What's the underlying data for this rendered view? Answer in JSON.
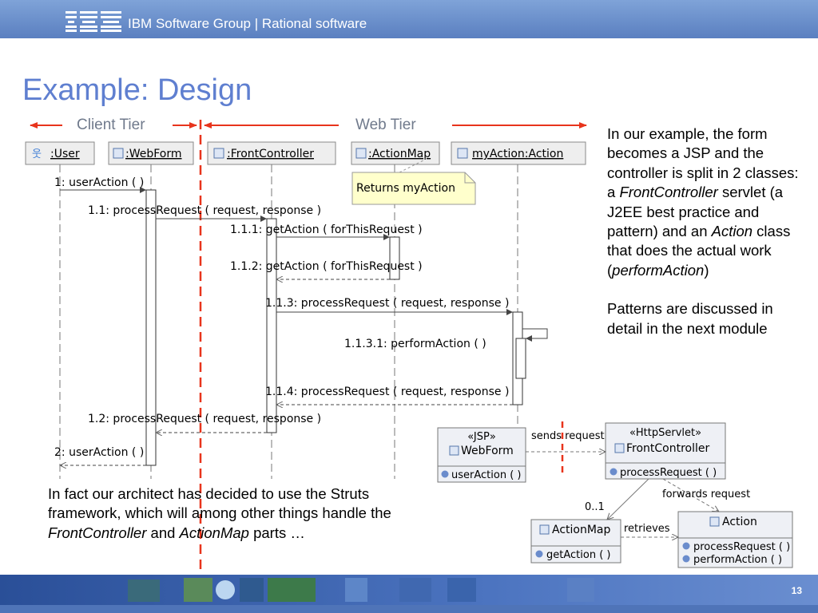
{
  "header": {
    "brand": "IBM",
    "group_text": "IBM Software Group | Rational software"
  },
  "slide": {
    "title": "Example: Design",
    "page_number": "13"
  },
  "tiers": {
    "client": "Client Tier",
    "web": "Web Tier"
  },
  "sequence": {
    "lifelines": [
      ":User",
      ":WebForm",
      ":FrontController",
      ":ActionMap",
      "myAction:Action"
    ],
    "note": "Returns myAction",
    "messages": {
      "m1": "1: userAction ( )",
      "m11": "1.1: processRequest ( request, response )",
      "m111": "1.1.1: getAction ( forThisRequest )",
      "m112": "1.1.2: getAction ( forThisRequest )",
      "m113": "1.1.3: processRequest ( request, response )",
      "m1131": "1.1.3.1: performAction ( )",
      "m114": "1.1.4: processRequest ( request, response )",
      "m12": "1.2: processRequest ( request, response )",
      "m2": "2: userAction ( )"
    }
  },
  "class_diagram": {
    "webform": {
      "stereotype": "«JSP»",
      "name": "WebForm",
      "op": "userAction ( )"
    },
    "frontcontroller": {
      "stereotype": "«HttpServlet»",
      "name": "FrontController",
      "op": "processRequest ( )"
    },
    "actionmap": {
      "name": "ActionMap",
      "op": "getAction ( )"
    },
    "action": {
      "name": "Action",
      "op1": "processRequest ( )",
      "op2": "performAction ( )"
    },
    "labels": {
      "sends": "sends request",
      "forwards": "forwards request",
      "mult": "0..1",
      "retrieves": "retrieves"
    }
  },
  "side_text": {
    "p1_a": "In our example, the form becomes a JSP and the controller is split in 2 classes: a ",
    "p1_b": "FrontController",
    "p1_c": " servlet (a J2EE best practice and pattern) and an ",
    "p1_d": "Action",
    "p1_e": " class that does the actual work (",
    "p1_f": "performAction",
    "p1_g": ")",
    "p2": "Patterns are discussed in detail in the next module"
  },
  "bottom_text": {
    "a": "In fact our architect has decided to use the Struts framework, which will among other things handle the ",
    "b": "FrontController",
    "c": " and ",
    "d": "ActionMap",
    "e": " parts …"
  },
  "colors": {
    "title": "#5f7fd0",
    "red": "#e8341c",
    "header": "#6a90cf"
  }
}
